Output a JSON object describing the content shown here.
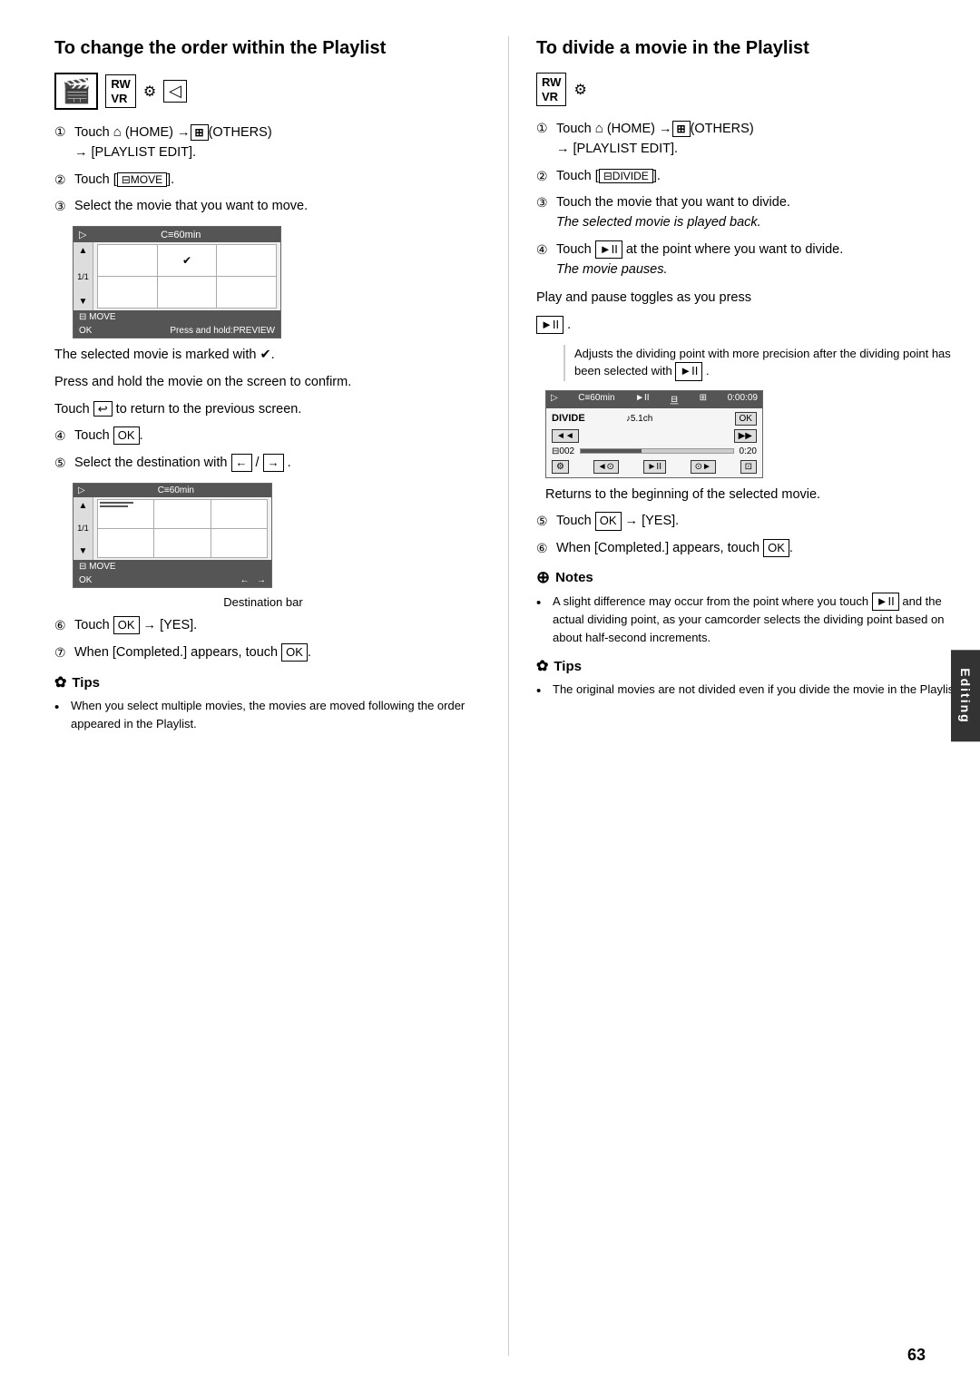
{
  "left": {
    "title": "To change the order within the Playlist",
    "steps": [
      {
        "num": "①",
        "text": "Touch",
        "home": "⌂",
        "homeLabel": "(HOME)",
        "arrow": "→",
        "others": "⊞",
        "othersLabel": "(OTHERS)",
        "line2": "→ [PLAYLIST EDIT]."
      },
      {
        "num": "②",
        "text": "Touch [",
        "btn": "⊟",
        "btnLabel": "MOVE",
        "end": "]."
      },
      {
        "num": "③",
        "text": "Select the movie that you want to move."
      }
    ],
    "note1": "The selected movie is marked with ✔.",
    "note2": "Press and hold the movie on the screen to confirm.",
    "note3_prefix": "Touch",
    "note3_btn": "↩",
    "note3_suffix": "to return to the previous screen.",
    "step4": {
      "num": "④",
      "text": "Touch",
      "btn": "OK"
    },
    "step5": {
      "num": "⑤",
      "text": "Select the destination with",
      "btn1": "←",
      "btn2": "→"
    },
    "destination_label": "Destination bar",
    "step6": {
      "num": "⑥",
      "text": "Touch",
      "btn": "OK",
      "arrow": "→",
      "result": "[YES]."
    },
    "step7": {
      "num": "⑦",
      "text": "When [Completed.] appears, touch",
      "btn": "OK"
    },
    "tips": {
      "title": "Tips",
      "items": [
        "When you select multiple movies, the movies are moved following the order appeared in the Playlist."
      ]
    },
    "screen1": {
      "header_left": "▷",
      "header_mid": "C≡60min",
      "footer_label": "MOVE",
      "footer_btn": "OK",
      "footer_right": "Press and hold:PREVIEW"
    },
    "screen2": {
      "header_left": "▷",
      "header_mid": "C≡60min",
      "sidebar_top": "▲",
      "sidebar_label": "1/1",
      "sidebar_bot": "▼",
      "footer_label": "MOVE",
      "footer_btn": "OK",
      "arrows": "← →"
    }
  },
  "right": {
    "title": "To divide a movie in the Playlist",
    "steps": [
      {
        "num": "①",
        "text": "Touch",
        "home": "⌂",
        "homeLabel": "(HOME)",
        "arrow": "→",
        "others": "⊞",
        "othersLabel": "(OTHERS)",
        "line2": "→ [PLAYLIST EDIT]."
      },
      {
        "num": "②",
        "text": "Touch [",
        "btn": "⊟",
        "btnLabel": "DIVIDE",
        "end": "]."
      },
      {
        "num": "③",
        "text": "Touch the movie that you want to divide.",
        "sub": "The selected movie is played back."
      },
      {
        "num": "④",
        "text_before": "Touch",
        "btn": "►II",
        "text_after": "at the point where you want to divide.",
        "sub": "The movie pauses."
      }
    ],
    "play_pause_text": "Play and pause toggles as you press",
    "play_pause_btn": "►II",
    "adjusts_note": "Adjusts the dividing point with more precision after the dividing point has been selected with",
    "adjusts_btn": "►II",
    "returns_text": "Returns to the beginning of the selected movie.",
    "step5": {
      "num": "⑤",
      "text": "Touch",
      "btn": "OK",
      "arrow": "→",
      "result": "[YES]."
    },
    "step6": {
      "num": "⑥",
      "text": "When [Completed.] appears, touch",
      "btn": "OK"
    },
    "notes": {
      "title": "Notes",
      "items": [
        "A slight difference may occur from the point where you touch ►II and the actual dividing point, as your camcorder selects the dividing point based on about half-second increments."
      ]
    },
    "tips": {
      "title": "Tips",
      "items": [
        "The original movies are not divided even if you divide the movie in the Playlist."
      ]
    },
    "divide_screen": {
      "header_left": "▷",
      "header_mid": "C≡60min",
      "header_play": "►II",
      "header_icon": "⊞",
      "header_time": "0:00:09",
      "label_divide": "DIVIDE",
      "label_ch": "♪5.1ch",
      "btn_ok": "OK",
      "btn_rew": "◄◄",
      "btn_ff": "▶▶",
      "num": "002",
      "time2": "0:20"
    }
  },
  "sidebar_label": "Editing",
  "page_number": "63"
}
